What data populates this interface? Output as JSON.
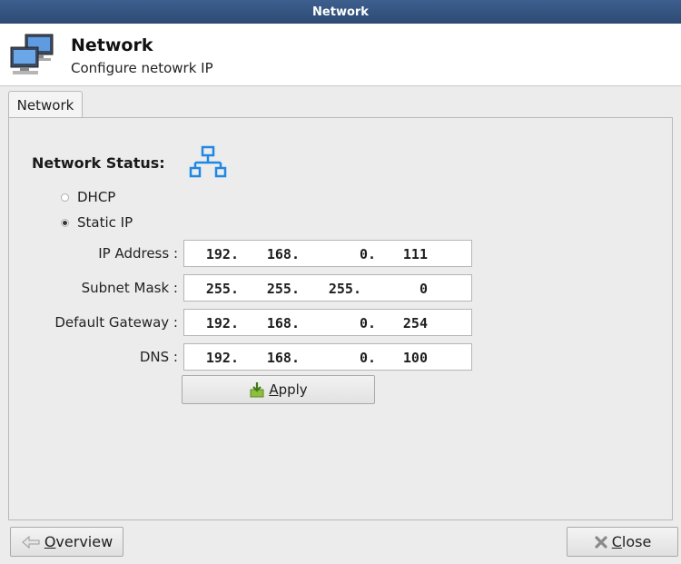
{
  "window": {
    "title": "Network"
  },
  "header": {
    "title": "Network",
    "subtitle": "Configure netowrk IP",
    "icon": "network-computers-icon"
  },
  "tabs": [
    {
      "label": "Network",
      "active": true
    }
  ],
  "status": {
    "label": "Network Status:",
    "icon": "network-topology-icon",
    "icon_color": "#1e88e5"
  },
  "mode": {
    "options": [
      {
        "label": "DHCP",
        "selected": false
      },
      {
        "label": "Static IP",
        "selected": true
      }
    ]
  },
  "fields": [
    {
      "label": "IP Address :",
      "octets": [
        "192.",
        "168.",
        "0.",
        "111"
      ]
    },
    {
      "label": "Subnet Mask :",
      "octets": [
        "255.",
        "255.",
        "255.",
        "0"
      ]
    },
    {
      "label": "Default Gateway :",
      "octets": [
        "192.",
        "168.",
        "0.",
        "254"
      ]
    },
    {
      "label": "DNS :",
      "octets": [
        "192.",
        "168.",
        "0.",
        "100"
      ]
    }
  ],
  "buttons": {
    "apply": {
      "label_prefix": "",
      "mnemonic": "A",
      "label_rest": "pply",
      "icon": "apply-arrow-icon"
    },
    "overview": {
      "mnemonic": "O",
      "label_rest": "verview",
      "icon": "back-arrow-icon"
    },
    "close": {
      "mnemonic": "C",
      "label_rest": "lose",
      "icon": "close-x-icon"
    }
  }
}
